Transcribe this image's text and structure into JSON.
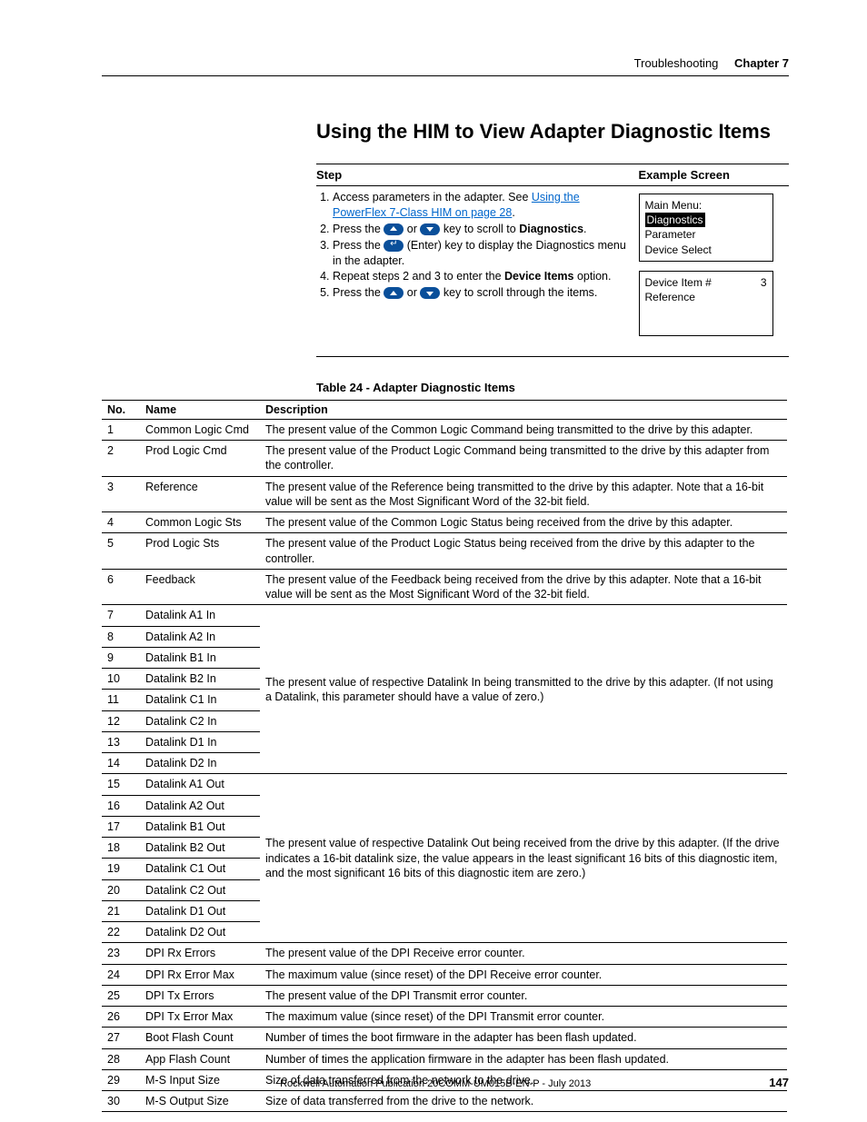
{
  "header": {
    "section": "Troubleshooting",
    "chapter": "Chapter 7"
  },
  "title": "Using the HIM to View Adapter Diagnostic Items",
  "stepTable": {
    "headStep": "Step",
    "headExample": "Example Screen",
    "s1a": "Access parameters in the adapter. See ",
    "s1link": "Using the PowerFlex 7-Class HIM on page 28",
    "s1b": ".",
    "s2a": "Press the ",
    "s2b": " or ",
    "s2c": " key to scroll to ",
    "s2d": "Diagnostics",
    "s2e": ".",
    "s3a": "Press the ",
    "s3b": " (Enter) key to display the Diagnostics menu in the adapter.",
    "s4a": "Repeat steps 2 and 3 to enter the ",
    "s4b": "Device Items",
    "s4c": " option.",
    "s5a": "Press the ",
    "s5b": " or ",
    "s5c": " key to scroll through the items."
  },
  "lcd1": {
    "l1": "Main Menu:",
    "l2": "Diagnostics",
    "l3": "Parameter",
    "l4": "Device Select"
  },
  "lcd2": {
    "l1a": "Device Item #",
    "l1b": "3",
    "l2": "Reference"
  },
  "caption": "Table 24 - Adapter Diagnostic Items",
  "diagHead": {
    "no": "No.",
    "name": "Name",
    "desc": "Description"
  },
  "rows": {
    "r1": {
      "no": "1",
      "name": "Common Logic Cmd",
      "desc": "The present value of the Common Logic Command being transmitted to the drive by this adapter."
    },
    "r2": {
      "no": "2",
      "name": "Prod Logic Cmd",
      "desc": "The present value of the Product Logic Command being transmitted to the drive by this adapter from the controller."
    },
    "r3": {
      "no": "3",
      "name": "Reference",
      "desc": "The present value of the Reference being transmitted to the drive by this adapter. Note that a 16-bit value will be sent as the Most Significant Word of the 32-bit field."
    },
    "r4": {
      "no": "4",
      "name": "Common Logic Sts",
      "desc": "The present value of the Common Logic Status being received from the drive by this adapter."
    },
    "r5": {
      "no": "5",
      "name": "Prod Logic Sts",
      "desc": "The present value of the Product Logic Status being received from the drive by this adapter to the controller."
    },
    "r6": {
      "no": "6",
      "name": "Feedback",
      "desc": "The present value of the Feedback being received from the drive by this adapter. Note that a 16-bit value will be sent as the Most Significant Word of the 32-bit field."
    },
    "r7": {
      "no": "7",
      "name": "Datalink A1 In"
    },
    "r8": {
      "no": "8",
      "name": "Datalink A2 In"
    },
    "r9": {
      "no": "9",
      "name": "Datalink B1 In"
    },
    "r10": {
      "no": "10",
      "name": "Datalink B2 In"
    },
    "r11": {
      "no": "11",
      "name": "Datalink C1 In"
    },
    "r12": {
      "no": "12",
      "name": "Datalink C2 In"
    },
    "r13": {
      "no": "13",
      "name": "Datalink D1 In"
    },
    "r14": {
      "no": "14",
      "name": "Datalink D2 In"
    },
    "grpInDesc": "The present value of respective Datalink In being transmitted to the drive by this adapter. (If not using a Datalink, this parameter should have a value of zero.)",
    "r15": {
      "no": "15",
      "name": "Datalink A1 Out"
    },
    "r16": {
      "no": "16",
      "name": "Datalink A2 Out"
    },
    "r17": {
      "no": "17",
      "name": "Datalink B1 Out"
    },
    "r18": {
      "no": "18",
      "name": "Datalink B2 Out"
    },
    "r19": {
      "no": "19",
      "name": "Datalink C1 Out"
    },
    "r20": {
      "no": "20",
      "name": "Datalink C2 Out"
    },
    "r21": {
      "no": "21",
      "name": "Datalink D1 Out"
    },
    "r22": {
      "no": "22",
      "name": "Datalink D2 Out"
    },
    "grpOutDesc": "The present value of respective Datalink Out being received from the drive by this adapter. (If the drive indicates a 16-bit datalink size, the value appears in the least significant 16 bits of this diagnostic item, and the most significant 16 bits of this diagnostic item are zero.)",
    "r23": {
      "no": "23",
      "name": "DPI Rx Errors",
      "desc": "The present value of the DPI Receive error counter."
    },
    "r24": {
      "no": "24",
      "name": "DPI Rx Error Max",
      "desc": "The maximum value (since reset) of the DPI Receive error counter."
    },
    "r25": {
      "no": "25",
      "name": "DPI Tx Errors",
      "desc": "The present value of the DPI Transmit error counter."
    },
    "r26": {
      "no": "26",
      "name": "DPI Tx Error Max",
      "desc": "The maximum value (since reset) of the DPI Transmit error counter."
    },
    "r27": {
      "no": "27",
      "name": "Boot Flash Count",
      "desc": "Number of times the boot firmware in the adapter has been flash updated."
    },
    "r28": {
      "no": "28",
      "name": "App Flash Count",
      "desc": "Number of times the application firmware in the adapter has been flash updated."
    },
    "r29": {
      "no": "29",
      "name": "M-S Input Size",
      "desc": "Size of data transferred from the network to the drive."
    },
    "r30": {
      "no": "30",
      "name": "M-S Output Size",
      "desc": "Size of data transferred from the drive to the network."
    }
  },
  "footer": {
    "pub": "Rockwell Automation Publication  20COMM-UM015B-EN-P - July 2013",
    "page": "147"
  }
}
